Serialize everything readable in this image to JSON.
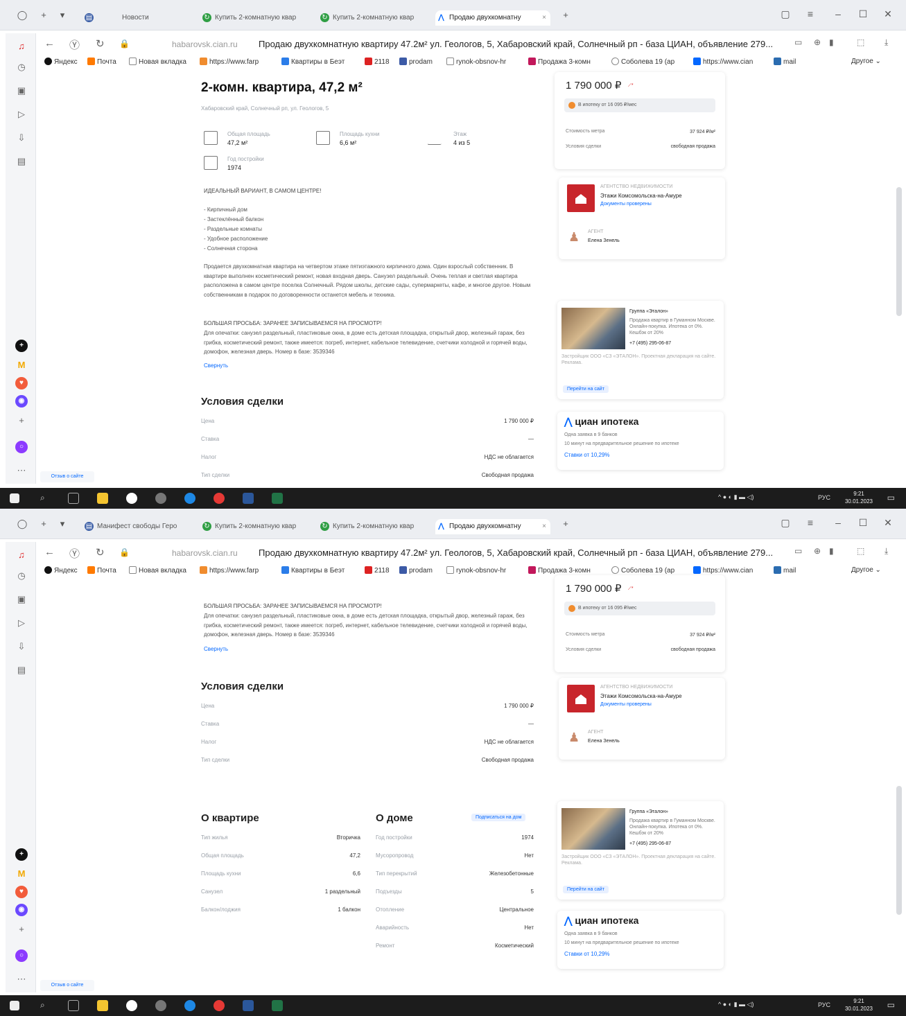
{
  "browser": {
    "tabs_shot1": [
      "Новости",
      "Купить 2-комнатную квар",
      "Купить 2-комнатную квар",
      "Продаю двухкомнатну"
    ],
    "tabs_shot2": [
      "Манифест свободы Геро",
      "Купить 2-комнатную квар",
      "Купить 2-комнатную квар",
      "Продаю двухкомнатну"
    ],
    "url_domain": "habarovsk.cian.ru",
    "page_title": "Продаю двухкомнатную квартиру 47.2м² ул. Геологов, 5, Хабаровский край, Солнечный рп - база ЦИАН, объявление 279...",
    "bookmarks": [
      "Яндекс",
      "Почта",
      "Новая вкладка",
      "https://www.farp",
      "Квартиры в Беэт",
      "2118",
      "prodam",
      "rynok-obsnov-hr",
      "Продажа 3-комн",
      "Соболева 19 (ар",
      "https://www.cian",
      "mail",
      "Другое"
    ]
  },
  "listing": {
    "title": "2-комн. квартира, 47,2 м²",
    "address": "Хабаровский край, Солнечный рп, ул. Геологов, 5",
    "facts": [
      {
        "label": "Общая площадь",
        "value": "47,2 м²"
      },
      {
        "label": "Площадь кухни",
        "value": "6,6 м²"
      },
      {
        "label": "Этаж",
        "value": "4 из 5"
      },
      {
        "label": "Год постройки",
        "value": "1974"
      }
    ],
    "headline": "ИДЕАЛЬНЫЙ ВАРИАНТ, В САМОМ ЦЕНТРЕ!",
    "bullets": [
      "- Кирпичный дом",
      "- Застеклённый балкон",
      "- Раздельные комнаты",
      "- Удобное расположение",
      "- Солнечная сторона"
    ],
    "desc1": "Продается двухкомнатная квартира на четвертом этаже пятиэтажного кирпичного дома. Один взрослый собственник. В квартире выполнен косметический ремонт, новая входная дверь. Санузел раздельный. Очень теплая и светлая квартира расположена в самом центре поселка Солнечный. Рядом школы, детские сады, супермаркеты, кафе, и многое другое. Новым собственникам в подарок по договоренности останется мебель и техника.",
    "headline2": "БОЛЬШАЯ ПРОСЬБА: ЗАРАНЕЕ ЗАПИСЫВАЕМСЯ НА ПРОСМОТР!",
    "desc2": "Для опечатки: санузел раздельный, пластиковые окна, в доме есть детская площадка, открытый двор, железный гараж, без грибка, косметический ремонт, также имеется: погреб, интернет, кабельное телевидение, счетчики холодной и горячей воды, домофон, железная дверь. Номер в базе: 3539346",
    "collapse": "Свернуть"
  },
  "deal": {
    "title": "Условия сделки",
    "rows": [
      {
        "k": "Цена",
        "v": "1 790 000 ₽"
      },
      {
        "k": "Ставка",
        "v": "—"
      },
      {
        "k": "Налог",
        "v": "НДС не облагается"
      },
      {
        "k": "Тип сделки",
        "v": "Свободная продажа"
      }
    ]
  },
  "about_flat": {
    "title": "О квартире",
    "rows": [
      {
        "k": "Тип жилья",
        "v": "Вторичка"
      },
      {
        "k": "Общая площадь",
        "v": "47,2"
      },
      {
        "k": "Площадь кухни",
        "v": "6,6"
      },
      {
        "k": "Санузел",
        "v": "1 раздельный"
      },
      {
        "k": "Балкон/лоджия",
        "v": "1 балкон"
      }
    ]
  },
  "about_house": {
    "title": "О доме",
    "badge": "Подписаться на дом",
    "rows": [
      {
        "k": "Год постройки",
        "v": "1974"
      },
      {
        "k": "Мусоропровод",
        "v": "Нет"
      },
      {
        "k": "Тип перекрытий",
        "v": "Железобетонные"
      },
      {
        "k": "Подъезды",
        "v": "5"
      },
      {
        "k": "Отопление",
        "v": "Центральное"
      },
      {
        "k": "Аварийность",
        "v": "Нет"
      },
      {
        "k": "Ремонт",
        "v": "Косметический"
      }
    ]
  },
  "sidebar_card": {
    "price": "1 790 000 ₽",
    "mortgage": "В ипотеку от 16 095 ₽/мес",
    "row1_k": "Стоимость метра",
    "row1_v": "37 924 ₽/м²",
    "row2_k": "Условия сделки",
    "row2_v": "свободная продажа"
  },
  "agency": {
    "label": "АГЕНТСТВО НЕДВИЖИМОСТИ",
    "name": "Этажи Комсомольска-на-Амуре",
    "docs": "Документы проверены",
    "agent_label": "АГЕНТ",
    "agent_name": "Елена Зенель"
  },
  "ad": {
    "title": "Группа «Эталон»",
    "text": "Продажа квартир в Гуманном Москве. Онлайн-покупка. Ипотека от 0%. Кешбэк от 20%",
    "phone": "+7 (495) 295-06-87",
    "fine": "Застройщик ООО «СЗ «ЭТАЛОН». Проектная декларация на сайте. Реклама.",
    "cta": "Перейти на сайт"
  },
  "ipoteka": {
    "brand": "циан ипотека",
    "line1": "Одна заявка в 9 банков",
    "line2": "10 минут на предварительное решение по ипотеке",
    "rate": "Ставки от 10,29%"
  },
  "footer": {
    "label": "Отзыв о сайте"
  },
  "taskbar": {
    "lang": "РУС",
    "time": "9:21",
    "date": "30.01.2023"
  }
}
